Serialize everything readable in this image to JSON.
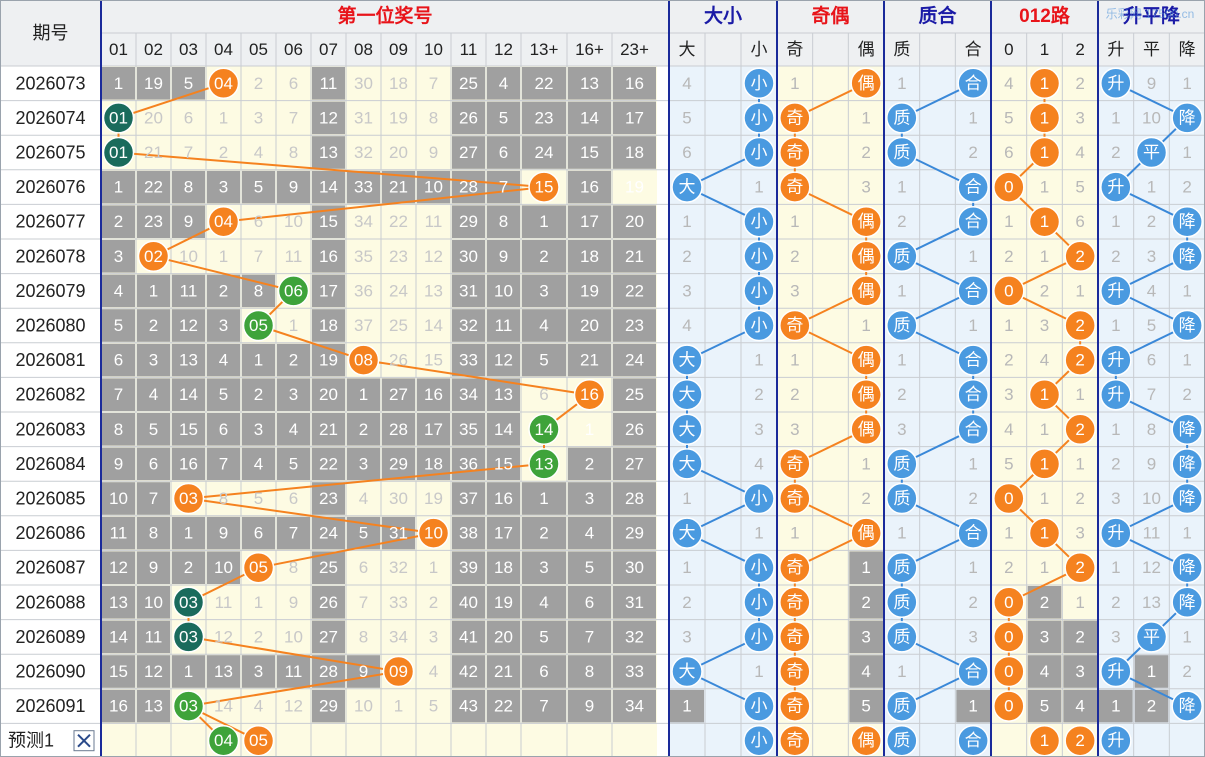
{
  "header": {
    "period_label": "期号",
    "group_first": "第一位奖号",
    "group_size": "大小",
    "group_parity": "奇偶",
    "group_prime": "质合",
    "group_mod": "012路",
    "group_trend": "升平降",
    "watermark": "乐彩网 17500.cn"
  },
  "columns": {
    "numbers": [
      "01",
      "02",
      "03",
      "04",
      "05",
      "06",
      "07",
      "08",
      "09",
      "10",
      "11",
      "12",
      "13+",
      "16+",
      "23+"
    ],
    "size": [
      "大",
      "",
      "小"
    ],
    "parity": [
      "奇",
      "",
      "偶"
    ],
    "prime": [
      "质",
      "",
      "合"
    ],
    "mod": [
      "0",
      "1",
      "2"
    ],
    "trend": [
      "升",
      "平",
      "降"
    ]
  },
  "colors": {
    "header_red": "#e8141a",
    "header_blue": "#1a1aa6",
    "orange_ball": "#f5821f",
    "green_ball": "#3ea33a",
    "teal_ball": "#1a6b5c",
    "blue_ball": "#4a9ae0",
    "gray_cell": "#a0a0a0",
    "cream": "#fdfbe3",
    "light_blue": "#eaf3fb",
    "line_orange": "#f5821f",
    "line_blue": "#3a88d8"
  },
  "rows": [
    {
      "period": "2026073",
      "first": 4,
      "miss": [
        "1",
        "19",
        "5",
        "04",
        "2",
        "6",
        "11",
        "30",
        "18",
        "7",
        "25",
        "4",
        "22",
        "13",
        "16"
      ],
      "size": [
        "4",
        "",
        "小"
      ],
      "parity": [
        "1",
        "",
        "偶"
      ],
      "prime": [
        "1",
        "",
        "合"
      ],
      "mod": [
        "4",
        "1",
        "2"
      ],
      "trend": [
        "升",
        "9",
        "1"
      ]
    },
    {
      "period": "2026074",
      "first": 1,
      "miss": [
        "01",
        "20",
        "6",
        "1",
        "3",
        "7",
        "12",
        "31",
        "19",
        "8",
        "26",
        "5",
        "23",
        "14",
        "17"
      ],
      "size": [
        "5",
        "",
        "小"
      ],
      "parity": [
        "奇",
        "",
        "1"
      ],
      "prime": [
        "质",
        "",
        "1"
      ],
      "mod": [
        "5",
        "1",
        "3"
      ],
      "trend": [
        "1",
        "10",
        "降"
      ]
    },
    {
      "period": "2026075",
      "first": 1,
      "miss": [
        "01",
        "21",
        "7",
        "2",
        "4",
        "8",
        "13",
        "32",
        "20",
        "9",
        "27",
        "6",
        "24",
        "15",
        "18"
      ],
      "size": [
        "6",
        "",
        "小"
      ],
      "parity": [
        "奇",
        "",
        "2"
      ],
      "prime": [
        "质",
        "",
        "2"
      ],
      "mod": [
        "6",
        "1",
        "4"
      ],
      "trend": [
        "2",
        "平",
        "1"
      ]
    },
    {
      "period": "2026076",
      "first": 15,
      "miss": [
        "1",
        "22",
        "8",
        "3",
        "5",
        "9",
        "14",
        "33",
        "21",
        "10",
        "28",
        "7",
        "15",
        "16",
        "19"
      ],
      "size": [
        "大",
        "",
        "1"
      ],
      "parity": [
        "奇",
        "",
        "3"
      ],
      "prime": [
        "1",
        "",
        "合"
      ],
      "mod": [
        "0",
        "1",
        "5"
      ],
      "trend": [
        "升",
        "1",
        "2"
      ]
    },
    {
      "period": "2026077",
      "first": 4,
      "miss": [
        "2",
        "23",
        "9",
        "04",
        "6",
        "10",
        "15",
        "34",
        "22",
        "11",
        "29",
        "8",
        "1",
        "17",
        "20"
      ],
      "size": [
        "1",
        "",
        "小"
      ],
      "parity": [
        "1",
        "",
        "偶"
      ],
      "prime": [
        "2",
        "",
        "合"
      ],
      "mod": [
        "1",
        "1",
        "6"
      ],
      "trend": [
        "1",
        "2",
        "降"
      ]
    },
    {
      "period": "2026078",
      "first": 2,
      "miss": [
        "3",
        "02",
        "10",
        "1",
        "7",
        "11",
        "16",
        "35",
        "23",
        "12",
        "30",
        "9",
        "2",
        "18",
        "21"
      ],
      "size": [
        "2",
        "",
        "小"
      ],
      "parity": [
        "2",
        "",
        "偶"
      ],
      "prime": [
        "质",
        "",
        "1"
      ],
      "mod": [
        "2",
        "1",
        "2"
      ],
      "trend": [
        "2",
        "3",
        "降"
      ]
    },
    {
      "period": "2026079",
      "first": 6,
      "miss": [
        "4",
        "1",
        "11",
        "2",
        "8",
        "06",
        "17",
        "36",
        "24",
        "13",
        "31",
        "10",
        "3",
        "19",
        "22"
      ],
      "size": [
        "3",
        "",
        "小"
      ],
      "parity": [
        "3",
        "",
        "偶"
      ],
      "prime": [
        "1",
        "",
        "合"
      ],
      "mod": [
        "0",
        "2",
        "1"
      ],
      "trend": [
        "升",
        "4",
        "1"
      ]
    },
    {
      "period": "2026080",
      "first": 5,
      "miss": [
        "5",
        "2",
        "12",
        "3",
        "05",
        "1",
        "18",
        "37",
        "25",
        "14",
        "32",
        "11",
        "4",
        "20",
        "23"
      ],
      "size": [
        "4",
        "",
        "小"
      ],
      "parity": [
        "奇",
        "",
        "1"
      ],
      "prime": [
        "质",
        "",
        "1"
      ],
      "mod": [
        "1",
        "3",
        "2"
      ],
      "trend": [
        "1",
        "5",
        "降"
      ]
    },
    {
      "period": "2026081",
      "first": 8,
      "miss": [
        "6",
        "3",
        "13",
        "4",
        "1",
        "2",
        "19",
        "08",
        "26",
        "15",
        "33",
        "12",
        "5",
        "21",
        "24"
      ],
      "size": [
        "大",
        "",
        "1"
      ],
      "parity": [
        "1",
        "",
        "偶"
      ],
      "prime": [
        "1",
        "",
        "合"
      ],
      "mod": [
        "2",
        "4",
        "2"
      ],
      "trend": [
        "升",
        "6",
        "1"
      ]
    },
    {
      "period": "2026082",
      "first": 16,
      "miss": [
        "7",
        "4",
        "14",
        "5",
        "2",
        "3",
        "20",
        "1",
        "27",
        "16",
        "34",
        "13",
        "6",
        "16",
        "25"
      ],
      "size": [
        "大",
        "",
        "2"
      ],
      "parity": [
        "2",
        "",
        "偶"
      ],
      "prime": [
        "2",
        "",
        "合"
      ],
      "mod": [
        "3",
        "1",
        "1"
      ],
      "trend": [
        "升",
        "7",
        "2"
      ]
    },
    {
      "period": "2026083",
      "first": 14,
      "miss": [
        "8",
        "5",
        "15",
        "6",
        "3",
        "4",
        "21",
        "2",
        "28",
        "17",
        "35",
        "14",
        "14",
        "1",
        "26"
      ],
      "size": [
        "大",
        "",
        "3"
      ],
      "parity": [
        "3",
        "",
        "偶"
      ],
      "prime": [
        "3",
        "",
        "合"
      ],
      "mod": [
        "4",
        "1",
        "2"
      ],
      "trend": [
        "1",
        "8",
        "降"
      ]
    },
    {
      "period": "2026084",
      "first": 13,
      "miss": [
        "9",
        "6",
        "16",
        "7",
        "4",
        "5",
        "22",
        "3",
        "29",
        "18",
        "36",
        "15",
        "13",
        "2",
        "27"
      ],
      "size": [
        "大",
        "",
        "4"
      ],
      "parity": [
        "奇",
        "",
        "1"
      ],
      "prime": [
        "质",
        "",
        "1"
      ],
      "mod": [
        "5",
        "1",
        "1"
      ],
      "trend": [
        "2",
        "9",
        "降"
      ]
    },
    {
      "period": "2026085",
      "first": 3,
      "miss": [
        "10",
        "7",
        "03",
        "8",
        "5",
        "6",
        "23",
        "4",
        "30",
        "19",
        "37",
        "16",
        "1",
        "3",
        "28"
      ],
      "size": [
        "1",
        "",
        "小"
      ],
      "parity": [
        "奇",
        "",
        "2"
      ],
      "prime": [
        "质",
        "",
        "2"
      ],
      "mod": [
        "0",
        "1",
        "2"
      ],
      "trend": [
        "3",
        "10",
        "降"
      ]
    },
    {
      "period": "2026086",
      "first": 10,
      "miss": [
        "11",
        "8",
        "1",
        "9",
        "6",
        "7",
        "24",
        "5",
        "31",
        "10",
        "38",
        "17",
        "2",
        "4",
        "29"
      ],
      "size": [
        "大",
        "",
        "1"
      ],
      "parity": [
        "1",
        "",
        "偶"
      ],
      "prime": [
        "1",
        "",
        "合"
      ],
      "mod": [
        "1",
        "1",
        "3"
      ],
      "trend": [
        "升",
        "11",
        "1"
      ]
    },
    {
      "period": "2026087",
      "first": 5,
      "miss": [
        "12",
        "9",
        "2",
        "10",
        "05",
        "8",
        "25",
        "6",
        "32",
        "1",
        "39",
        "18",
        "3",
        "5",
        "30"
      ],
      "size": [
        "1",
        "",
        "小"
      ],
      "parity": [
        "奇",
        "",
        "1"
      ],
      "prime": [
        "质",
        "",
        "1"
      ],
      "mod": [
        "2",
        "1",
        "2"
      ],
      "trend": [
        "1",
        "12",
        "降"
      ]
    },
    {
      "period": "2026088",
      "first": 3,
      "miss": [
        "13",
        "10",
        "03",
        "11",
        "1",
        "9",
        "26",
        "7",
        "33",
        "2",
        "40",
        "19",
        "4",
        "6",
        "31"
      ],
      "size": [
        "2",
        "",
        "小"
      ],
      "parity": [
        "奇",
        "",
        "2"
      ],
      "prime": [
        "质",
        "",
        "2"
      ],
      "mod": [
        "0",
        "2",
        "1"
      ],
      "trend": [
        "2",
        "13",
        "降"
      ]
    },
    {
      "period": "2026089",
      "first": 3,
      "miss": [
        "14",
        "11",
        "03",
        "12",
        "2",
        "10",
        "27",
        "8",
        "34",
        "3",
        "41",
        "20",
        "5",
        "7",
        "32"
      ],
      "size": [
        "3",
        "",
        "小"
      ],
      "parity": [
        "奇",
        "",
        "3"
      ],
      "prime": [
        "质",
        "",
        "3"
      ],
      "mod": [
        "0",
        "3",
        "2"
      ],
      "trend": [
        "3",
        "平",
        "1"
      ]
    },
    {
      "period": "2026090",
      "first": 9,
      "miss": [
        "15",
        "12",
        "1",
        "13",
        "3",
        "11",
        "28",
        "9",
        "09",
        "4",
        "42",
        "21",
        "6",
        "8",
        "33"
      ],
      "size": [
        "大",
        "",
        "1"
      ],
      "parity": [
        "奇",
        "",
        "4"
      ],
      "prime": [
        "1",
        "",
        "合"
      ],
      "mod": [
        "0",
        "4",
        "3"
      ],
      "trend": [
        "升",
        "1",
        "2"
      ]
    },
    {
      "period": "2026091",
      "first": 3,
      "miss": [
        "16",
        "13",
        "03",
        "14",
        "4",
        "12",
        "29",
        "10",
        "1",
        "5",
        "43",
        "22",
        "7",
        "9",
        "34"
      ],
      "size": [
        "1",
        "",
        "小"
      ],
      "parity": [
        "奇",
        "",
        "5"
      ],
      "prime": [
        "质",
        "",
        "1"
      ],
      "mod": [
        "0",
        "5",
        "4"
      ],
      "trend": [
        "1",
        "2",
        "降"
      ]
    }
  ],
  "predict": {
    "label": "预测1",
    "balls": [
      "04",
      "05"
    ],
    "size": "小",
    "parity": [
      "奇",
      "偶"
    ],
    "prime": [
      "质",
      "合"
    ],
    "mod": [
      "1",
      "2"
    ],
    "trend": "升"
  }
}
